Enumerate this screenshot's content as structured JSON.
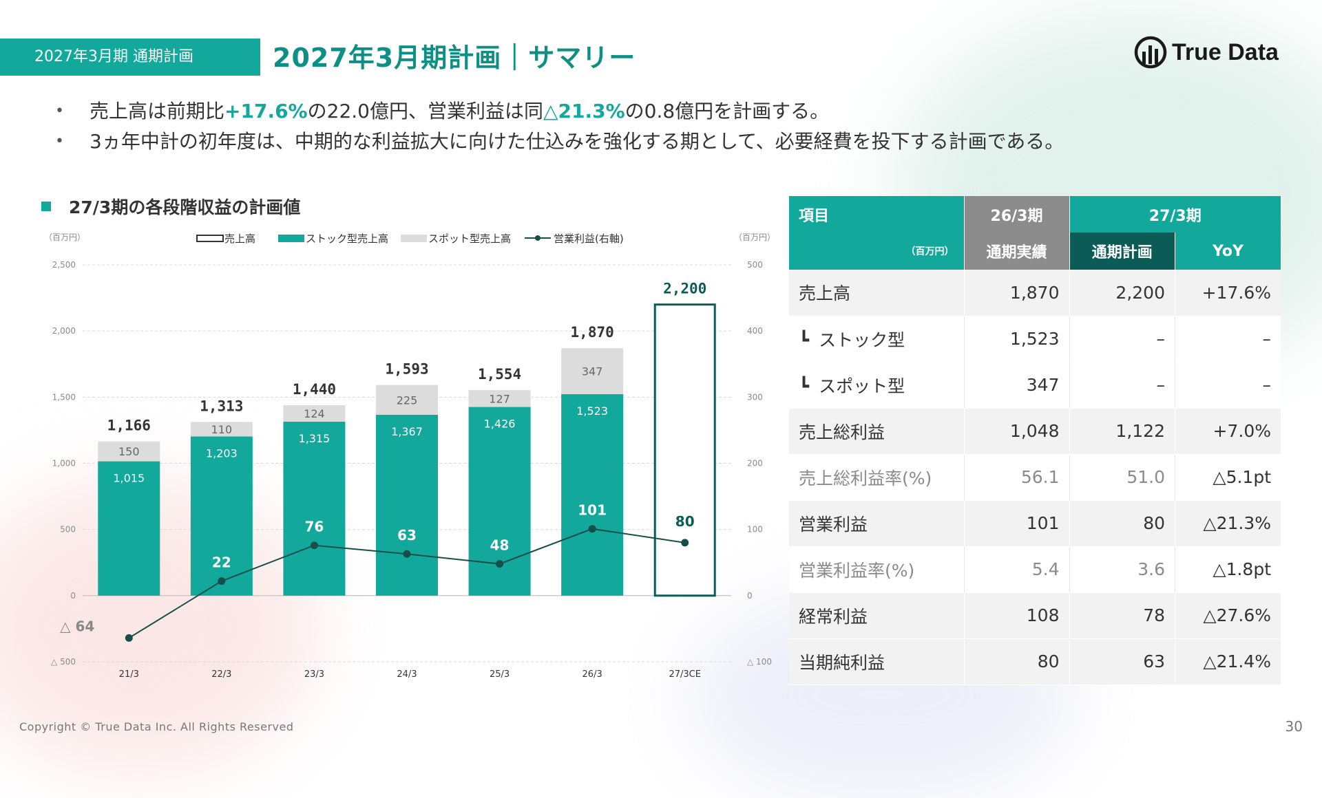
{
  "header": {
    "tag": "2027年3月期 通期計画",
    "title": "2027年3月期計画｜サマリー",
    "logo_text": "True Data"
  },
  "bullets": [
    {
      "parts": [
        "売上高は前期比",
        "+17.6%",
        "の22.0億円、営業利益は同",
        "△21.3%",
        "の0.8億円を計画する。"
      ]
    },
    {
      "text": "3ヵ年中計の初年度は、中期的な利益拡大に向けた仕込みを強化する期として、必要経費を投下する計画である。"
    }
  ],
  "chart_title": "27/3期の各段階収益の計画値",
  "colors": {
    "teal": "#12a89c",
    "spot_gray": "#dcdcdc",
    "line": "#164f4a",
    "dark_teal": "#0b5c56"
  },
  "chart_data": {
    "type": "bar",
    "left_unit": "（百万円）",
    "right_unit": "（百万円）",
    "legend": [
      "売上高",
      "ストック型売上高",
      "スポット型売上高",
      "営業利益(右軸)"
    ],
    "categories": [
      "21/3",
      "22/3",
      "23/3",
      "24/3",
      "25/3",
      "26/3",
      "27/3CE"
    ],
    "left_ticks": [
      "2,500",
      "2,000",
      "1,500",
      "1,000",
      "500",
      "0",
      "△ 500"
    ],
    "right_ticks": [
      "500",
      "400",
      "300",
      "200",
      "100",
      "0",
      "△ 100"
    ],
    "ylim_left": [
      -500,
      2500
    ],
    "ylim_right": [
      -100,
      500
    ],
    "series": [
      {
        "name": "ストック型売上高",
        "values": [
          1015,
          1203,
          1315,
          1367,
          1426,
          1523,
          null
        ],
        "labels": [
          "1,015",
          "1,203",
          "1,315",
          "1,367",
          "1,426",
          "1,523",
          ""
        ]
      },
      {
        "name": "スポット型売上高",
        "values": [
          150,
          110,
          124,
          225,
          127,
          347,
          null
        ],
        "labels": [
          "150",
          "110",
          "124",
          "225",
          "127",
          "347",
          ""
        ]
      },
      {
        "name": "売上高",
        "values": [
          1166,
          1313,
          1440,
          1593,
          1554,
          1870,
          2200
        ],
        "labels": [
          "1,166",
          "1,313",
          "1,440",
          "1,593",
          "1,554",
          "1,870",
          "2,200"
        ]
      },
      {
        "name": "営業利益(右軸)",
        "values": [
          -64,
          22,
          76,
          63,
          48,
          101,
          80
        ],
        "labels": [
          "△ 64",
          "22",
          "76",
          "63",
          "48",
          "101",
          "80"
        ]
      }
    ]
  },
  "table": {
    "header_item": "項目",
    "header_unit": "（百万円）",
    "col_group_prev": "26/3期",
    "col_group_plan": "27/3期",
    "col_actual": "通期実績",
    "col_plan": "通期計画",
    "col_yoy": "YoY",
    "rows": [
      {
        "label": "売上高",
        "actual": "1,870",
        "plan": "2,200",
        "yoy": "+17.6%"
      },
      {
        "label": "ストック型",
        "actual": "1,523",
        "plan": "–",
        "yoy": "–"
      },
      {
        "label": "スポット型",
        "actual": "347",
        "plan": "–",
        "yoy": "–"
      },
      {
        "label": "売上総利益",
        "actual": "1,048",
        "plan": "1,122",
        "yoy": "+7.0%"
      },
      {
        "label": "売上総利益率(%)",
        "actual": "56.1",
        "plan": "51.0",
        "yoy": "△5.1pt"
      },
      {
        "label": "営業利益",
        "actual": "101",
        "plan": "80",
        "yoy": "△21.3%"
      },
      {
        "label": "営業利益率(%)",
        "actual": "5.4",
        "plan": "3.6",
        "yoy": "△1.8pt"
      },
      {
        "label": "経常利益",
        "actual": "108",
        "plan": "78",
        "yoy": "△27.6%"
      },
      {
        "label": "当期純利益",
        "actual": "80",
        "plan": "63",
        "yoy": "△21.4%"
      }
    ]
  },
  "footer": {
    "copyright": "Copyright © True Data Inc. All Rights Reserved",
    "page": "30"
  }
}
